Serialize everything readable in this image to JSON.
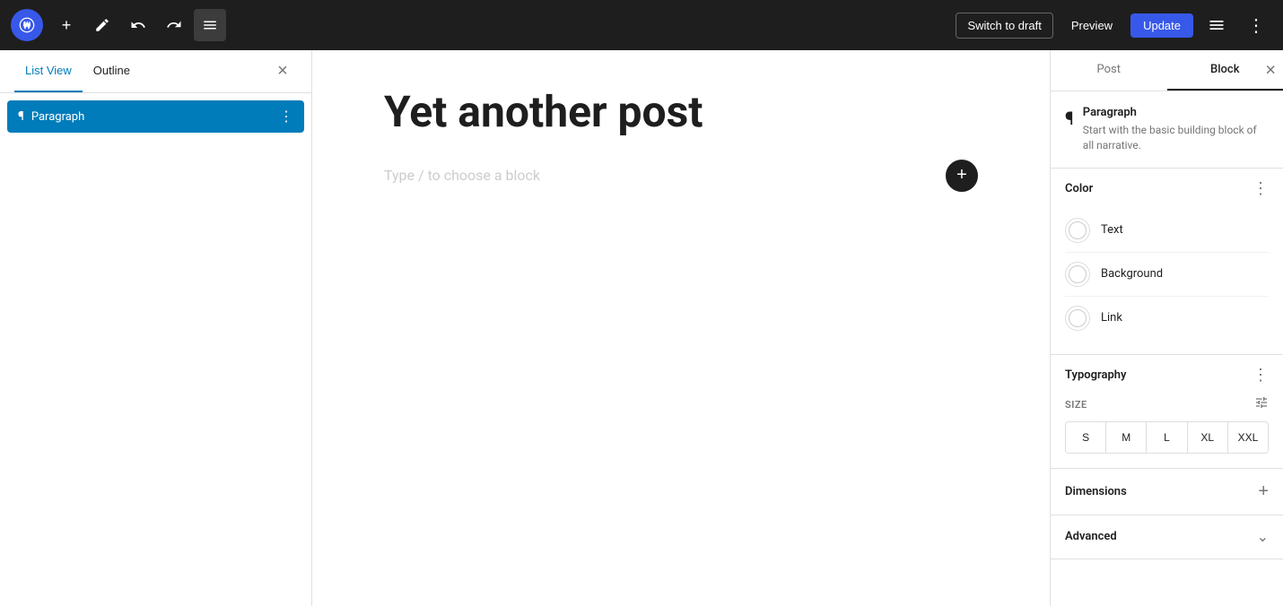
{
  "toolbar": {
    "add_label": "+",
    "edit_label": "✎",
    "undo_label": "↩",
    "redo_label": "↪",
    "list_view_label": "☰",
    "switch_to_draft_label": "Switch to draft",
    "preview_label": "Preview",
    "update_label": "Update",
    "more_label": "⋮"
  },
  "sidebar_left": {
    "tab_list_view": "List View",
    "tab_outline": "Outline",
    "close_label": "×",
    "items": [
      {
        "icon": "¶",
        "label": "Paragraph",
        "selected": true
      }
    ]
  },
  "editor": {
    "title": "Yet another post",
    "placeholder": "Type / to choose a block"
  },
  "sidebar_right": {
    "tab_post": "Post",
    "tab_block": "Block",
    "active_tab": "Block",
    "close_label": "×",
    "block": {
      "icon": "¶",
      "title": "Paragraph",
      "description": "Start with the basic building block of all narrative."
    },
    "color_section": {
      "title": "Color",
      "options_menu_label": "⋮",
      "options": [
        {
          "label": "Text"
        },
        {
          "label": "Background"
        },
        {
          "label": "Link"
        }
      ]
    },
    "typography_section": {
      "title": "Typography",
      "options_menu_label": "⋮",
      "size_label": "SIZE",
      "size_options": [
        "S",
        "M",
        "L",
        "XL",
        "XXL"
      ]
    },
    "dimensions_section": {
      "title": "Dimensions",
      "add_label": "+"
    },
    "advanced_section": {
      "title": "Advanced",
      "chevron_label": "⌄"
    }
  }
}
